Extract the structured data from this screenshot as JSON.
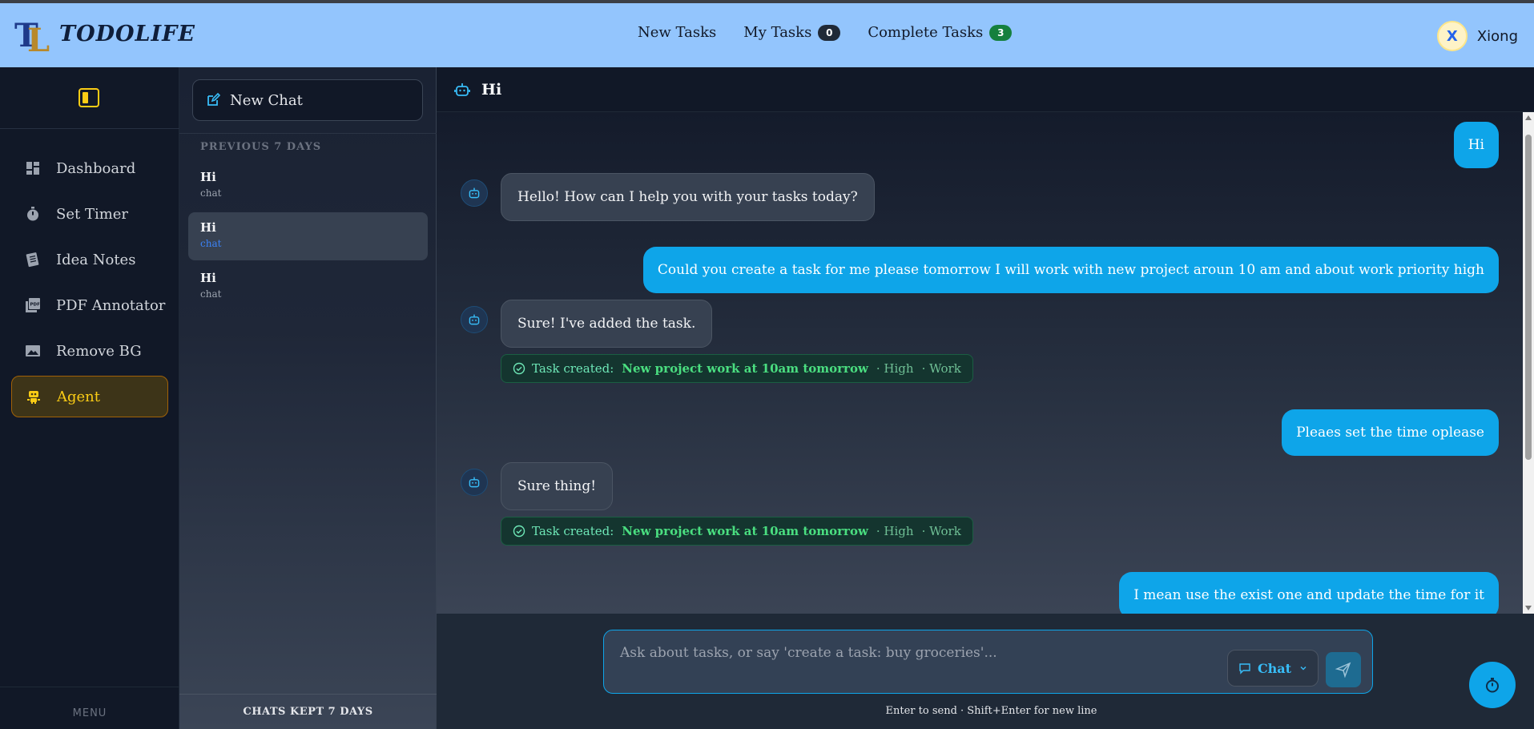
{
  "app": {
    "logo_text": "TODOLIFE",
    "logo_mark": "TL"
  },
  "topnav": {
    "new_tasks": "New Tasks",
    "my_tasks": "My Tasks",
    "my_tasks_count": "0",
    "complete_tasks": "Complete Tasks",
    "complete_tasks_count": "3"
  },
  "user": {
    "initial": "X",
    "name": "Xiong"
  },
  "sidebar": {
    "items": [
      {
        "label": "Dashboard",
        "icon": "dashboard-icon"
      },
      {
        "label": "Set Timer",
        "icon": "timer-icon"
      },
      {
        "label": "Idea Notes",
        "icon": "notes-icon"
      },
      {
        "label": "PDF Annotator",
        "icon": "pdf-icon"
      },
      {
        "label": "Remove BG",
        "icon": "image-icon"
      },
      {
        "label": "Agent",
        "icon": "robot-icon",
        "active": true
      }
    ],
    "footer": "MENU"
  },
  "chatlist": {
    "new_chat": "New Chat",
    "section": "PREVIOUS 7 DAYS",
    "items": [
      {
        "title": "Hi",
        "sub": "chat"
      },
      {
        "title": "Hi",
        "sub": "chat",
        "active": true
      },
      {
        "title": "Hi",
        "sub": "chat"
      }
    ],
    "footer": "CHATS KEPT 7 DAYS"
  },
  "chat": {
    "title": "Hi",
    "messages": [
      {
        "role": "user",
        "text": "Hi"
      },
      {
        "role": "bot",
        "text": "Hello! How can I help you with your tasks today?"
      },
      {
        "role": "user",
        "text": "Could you create a task for me please tomorrow I will work with new project aroun 10 am and about work priority high"
      },
      {
        "role": "bot",
        "text": "Sure! I've added the task.",
        "task": {
          "label": "Task created:",
          "name": "New project work at 10am tomorrow",
          "priority": "· High",
          "category": "· Work"
        }
      },
      {
        "role": "user",
        "text": "Pleaes set the time oplease"
      },
      {
        "role": "bot",
        "text": "Sure thing!",
        "task": {
          "label": "Task created:",
          "name": "New project work at 10am tomorrow",
          "priority": "· High",
          "category": "· Work"
        }
      },
      {
        "role": "user",
        "text": "I mean use the exist one and update the time for it"
      }
    ]
  },
  "composer": {
    "placeholder": "Ask about tasks, or say 'create a task: buy groceries'...",
    "mode": "Chat",
    "hint": "Enter to send · Shift+Enter for new line"
  },
  "colors": {
    "topbar": "#93c5fd",
    "accent": "#0ea5e9",
    "active_nav": "#facc15",
    "task_green": "#4ade80"
  }
}
